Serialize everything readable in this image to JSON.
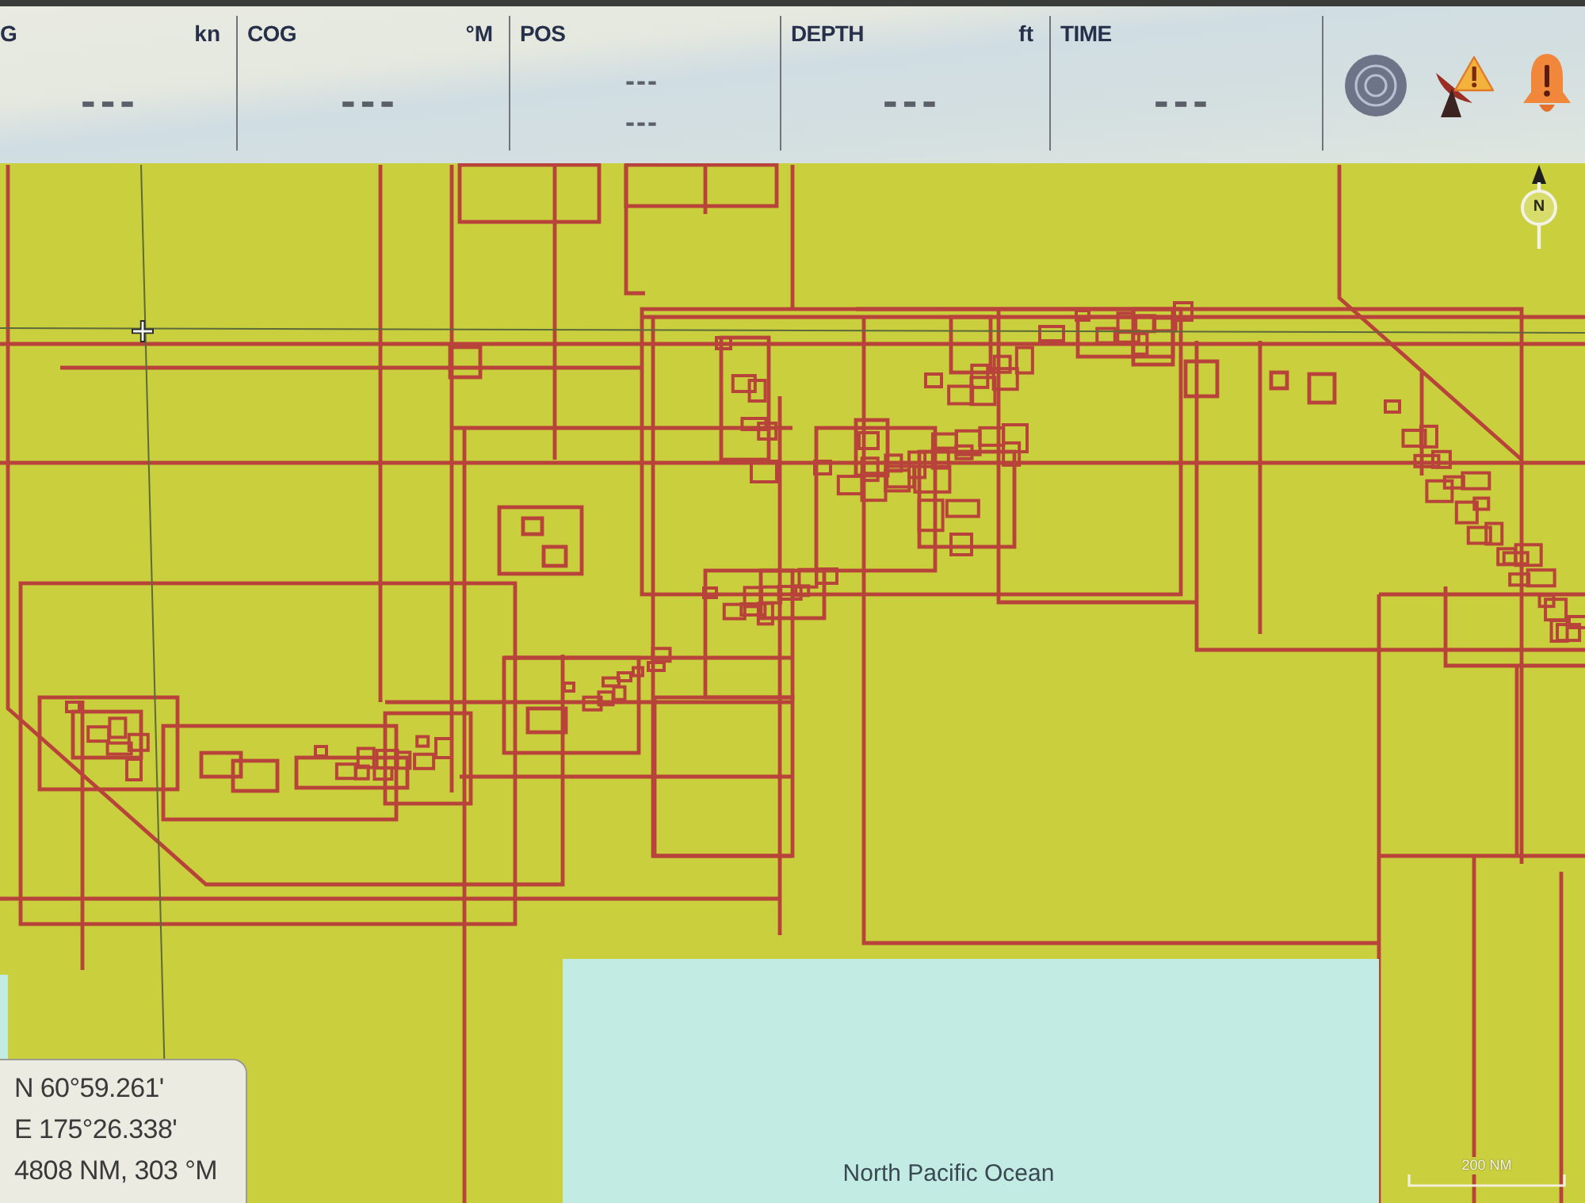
{
  "data_bar": {
    "fields": [
      {
        "label": "G",
        "unit": "kn",
        "values": [
          "---"
        ]
      },
      {
        "label": "COG",
        "unit": "°M",
        "values": [
          "---"
        ]
      },
      {
        "label": "POS",
        "values": [
          "---",
          "---"
        ]
      },
      {
        "label": "DEPTH",
        "unit": "ft",
        "values": [
          "---"
        ]
      },
      {
        "label": "TIME",
        "values": [
          "---"
        ]
      }
    ]
  },
  "chart": {
    "north_indicator": "N",
    "area_label": "North Pacific Ocean",
    "scale_label": "200 NM",
    "cursor_info": {
      "latitude": "N 60°59.261'",
      "longitude": "E 175°26.338'",
      "range_bearing": "4808 NM, 303 °M"
    }
  }
}
